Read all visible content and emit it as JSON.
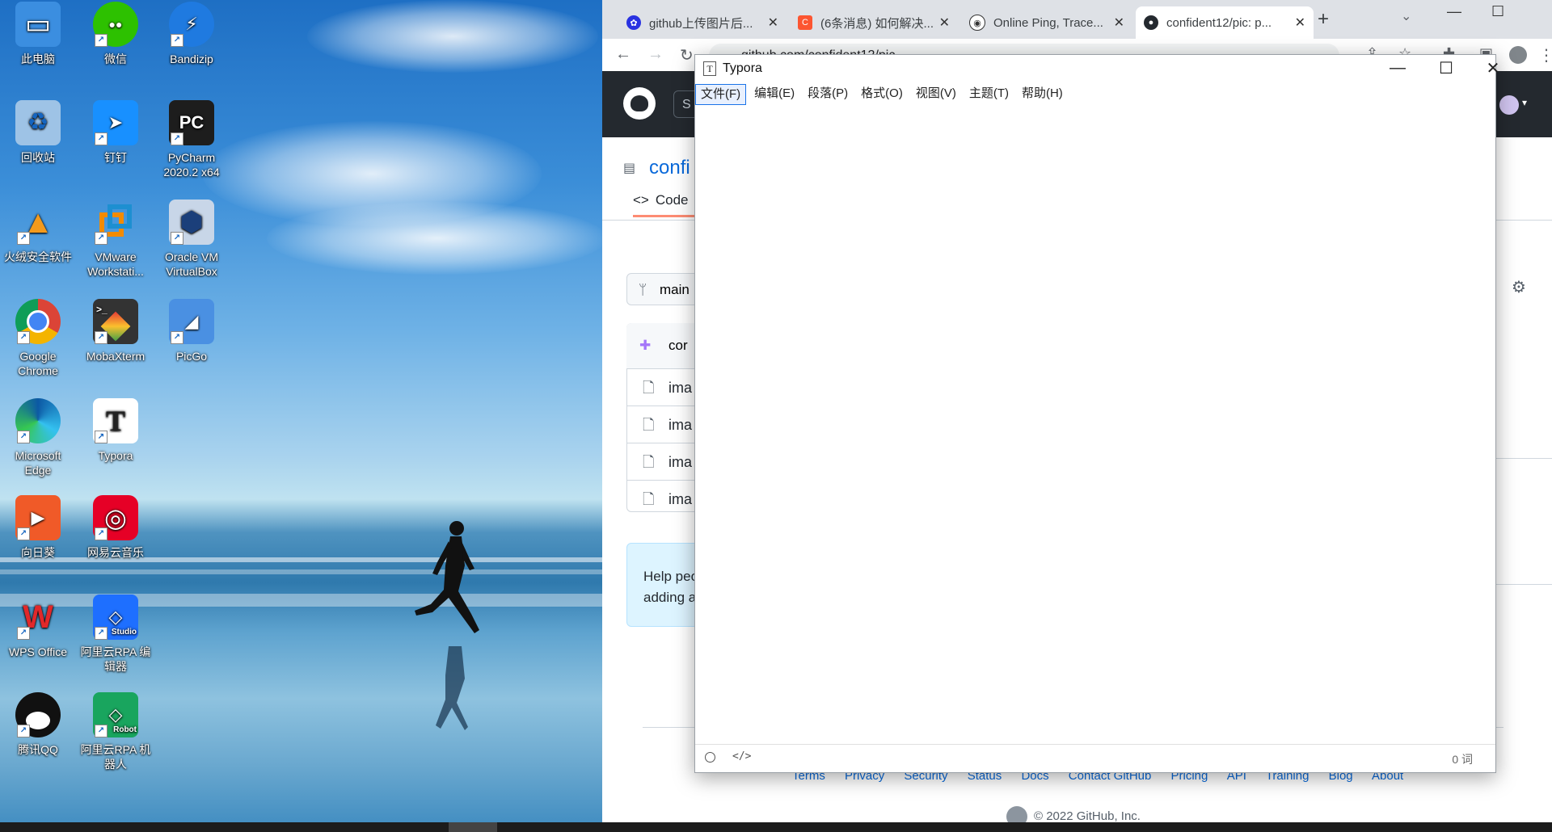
{
  "desktop": {
    "icons": [
      {
        "label": "此电脑",
        "icon": "computer-icon",
        "color": "#3b8ee0"
      },
      {
        "label": "微信",
        "icon": "wechat-icon",
        "color": "#2dc100"
      },
      {
        "label": "Bandizip",
        "icon": "bandizip-icon",
        "color": "#1f7ae0"
      },
      {
        "label": "回收站",
        "icon": "recycle-bin-icon",
        "color": "#9ec3e6"
      },
      {
        "label": "钉钉",
        "icon": "dingtalk-icon",
        "color": "#1890ff"
      },
      {
        "label": "PyCharm 2020.2 x64",
        "icon": "pycharm-icon",
        "color": "#1d1d1d"
      },
      {
        "label": "火绒安全软件",
        "icon": "huorong-icon",
        "color": "#f39a1d"
      },
      {
        "label": "VMware Workstati...",
        "icon": "vmware-icon",
        "color": "#f38b00"
      },
      {
        "label": "Oracle VM VirtualBox",
        "icon": "virtualbox-icon",
        "color": "#1b3f7a"
      },
      {
        "label": "Google Chrome",
        "icon": "chrome-icon",
        "color": "#dd4b39"
      },
      {
        "label": "MobaXterm",
        "icon": "mobaxterm-icon",
        "color": "#333333"
      },
      {
        "label": "PicGo",
        "icon": "picgo-icon",
        "color": "#4a90e2"
      },
      {
        "label": "Microsoft Edge",
        "icon": "edge-icon",
        "color": "#0c7bd6"
      },
      {
        "label": "Typora",
        "icon": "typora-icon",
        "color": "#ffffff"
      },
      {
        "label": "向日葵",
        "icon": "sunlogin-icon",
        "color": "#f05a28"
      },
      {
        "label": "网易云音乐",
        "icon": "netease-music-icon",
        "color": "#e60026"
      },
      {
        "label": "WPS Office",
        "icon": "wps-icon",
        "color": "#e1282a"
      },
      {
        "label": "阿里云RPA 编辑器",
        "icon": "aliyun-rpa-studio-icon",
        "color": "#1e6fff"
      },
      {
        "label": "腾讯QQ",
        "icon": "qq-icon",
        "color": "#111111"
      },
      {
        "label": "阿里云RPA 机器人",
        "icon": "aliyun-rpa-robot-icon",
        "color": "#19a55e"
      }
    ],
    "badge_studio": "Studio",
    "badge_robot": "Robot"
  },
  "browser": {
    "tabs": [
      {
        "title": "github上传图片后...",
        "icon": "baidu-icon",
        "color": "#2932e1",
        "active": false
      },
      {
        "title": "(6条消息) 如何解决...",
        "icon": "csdn-icon",
        "color": "#fc5531",
        "active": false
      },
      {
        "title": "Online Ping, Trace...",
        "icon": "ping-icon",
        "color": "#333333",
        "active": false
      },
      {
        "title": "confident12/pic: p...",
        "icon": "github-icon",
        "color": "#24292f",
        "active": true
      }
    ],
    "new_tab": "+",
    "url": "github.com/confident12/pic",
    "repo_name_partial": "confi",
    "code_tab": "Code",
    "branch_partial": "main",
    "commit_partial": "cor",
    "files": [
      "ima",
      "ima",
      "ima",
      "ima"
    ],
    "help_text_1": "Help peo",
    "help_text_2": "adding a",
    "search_partial": "S",
    "footer_links": [
      "Terms",
      "Privacy",
      "Security",
      "Status",
      "Docs",
      "Contact GitHub",
      "Pricing",
      "API",
      "Training",
      "Blog",
      "About"
    ],
    "copyright": "© 2022 GitHub, Inc."
  },
  "typora": {
    "title": "Typora",
    "menu": [
      "文件(F)",
      "编辑(E)",
      "段落(P)",
      "格式(O)",
      "视图(V)",
      "主题(T)",
      "帮助(H)"
    ],
    "selected_menu": "文件(F)",
    "word_count": "0 词",
    "minimize": "—",
    "maximize": "☐",
    "close": "✕"
  }
}
